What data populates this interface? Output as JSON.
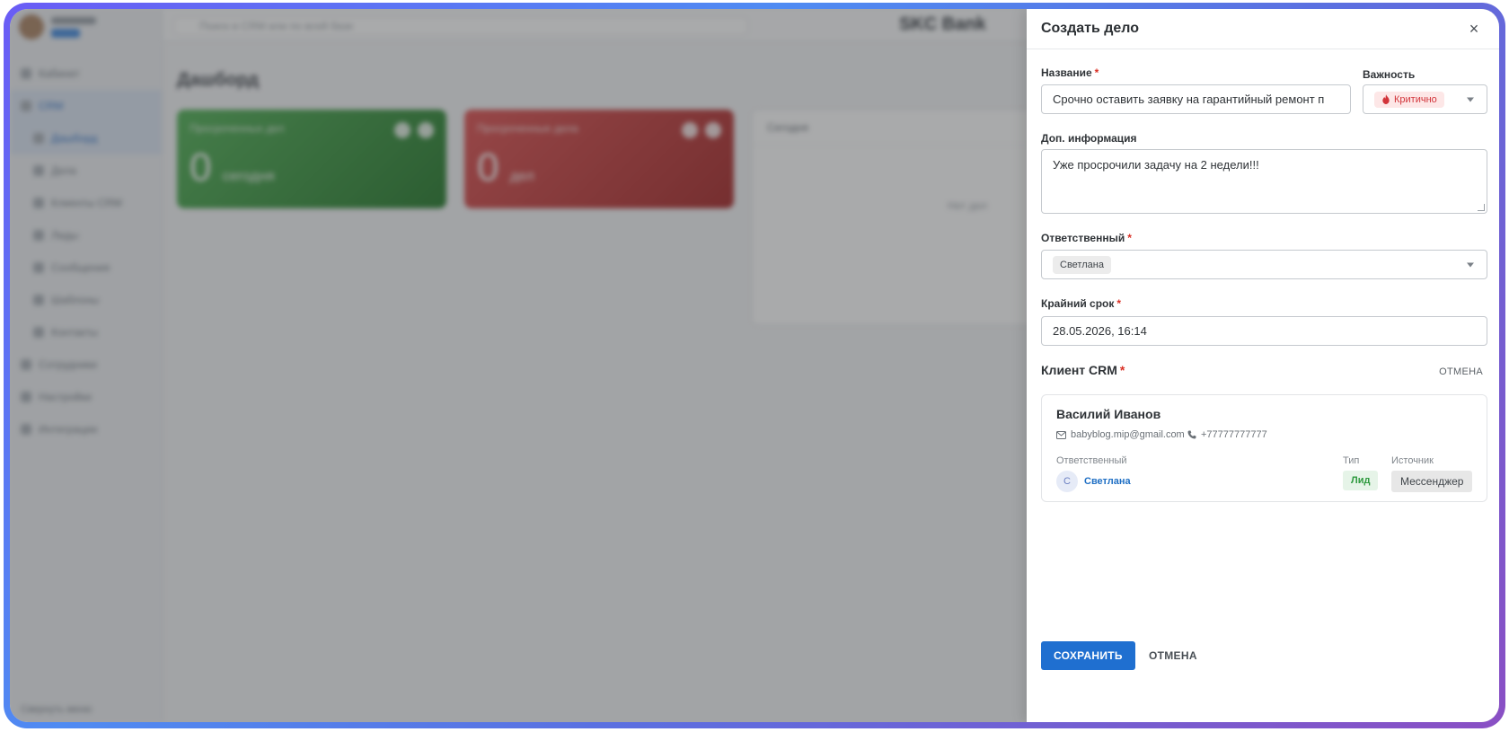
{
  "background": {
    "search_placeholder": "Поиск в CRM или по всей базе",
    "topbar_title": "SKC Bank",
    "dashboard_title": "Дашборд",
    "sidebar_items": [
      "Кабинет",
      "CRM",
      "Дашборд",
      "Дела",
      "Клиенты CRM",
      "Лиды",
      "Сообщения",
      "Шаблоны",
      "Контакты",
      "Сотрудники",
      "Настройки",
      "Интеграции"
    ],
    "sidebar_bottom": "Свернуть меню",
    "card_green_label": "Просроченных дел",
    "card_green_unit": "сегодня",
    "card_red_label": "Просроченные дела",
    "card_red_unit": "дел",
    "card_value": "0",
    "panel_head": "Сегодня",
    "panel_empty": "Нет дел"
  },
  "drawer": {
    "title": "Создать дело",
    "close": "×",
    "name_label": "Название",
    "name_value": "Срочно оставить заявку на гарантийный ремонт п",
    "priority_label": "Важность",
    "priority_value": "Критично",
    "info_label": "Доп. информация",
    "info_value": "Уже просрочили задачу на 2 недели!!!",
    "responsible_label": "Ответственный",
    "responsible_value": "Светлана",
    "deadline_label": "Крайний срок",
    "deadline_value": "28.05.2026, 16:14",
    "client_section": "Клиент CRM",
    "client_cancel": "ОТМЕНА",
    "required_mark": "*",
    "client": {
      "name": "Василий Иванов",
      "email": "babyblog.mip@gmail.com",
      "phone": "+77777777777",
      "responsible_label": "Ответственный",
      "responsible_initial": "С",
      "responsible_name": "Светлана",
      "type_label": "Тип",
      "type_value": "Лид",
      "source_label": "Источник",
      "source_value": "Мессенджер"
    },
    "save_label": "СОХРАНИТЬ",
    "cancel_label": "ОТМЕНА"
  },
  "colors": {
    "accent": "#1f6fd0",
    "required": "#d93025",
    "critical": "#d2343a",
    "lead": "#2e9a3e"
  }
}
